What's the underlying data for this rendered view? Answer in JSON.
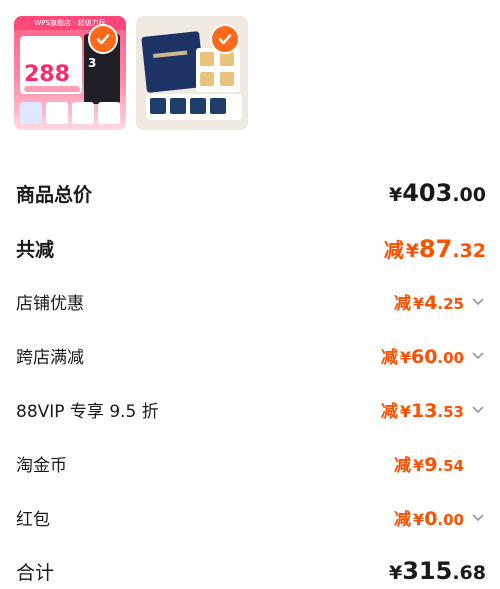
{
  "products": [
    {
      "name": "wps-product-thumb",
      "selected": true,
      "texts": {
        "band": "WPS旗舰店 · 超级力荐",
        "promo_number": "288",
        "badge": "3"
      }
    },
    {
      "name": "cookie-product-thumb",
      "selected": true
    }
  ],
  "summary": {
    "total_price": {
      "label": "商品总价",
      "yen": "¥",
      "int": "403",
      "dec": ".00"
    },
    "total_discount": {
      "label": "共减",
      "prefix": "减",
      "yen": "¥",
      "int": "87",
      "dec": ".32"
    },
    "items": [
      {
        "label": "店铺优惠",
        "prefix": "减",
        "yen": "¥",
        "int": "4",
        "dec": ".25",
        "expand": true
      },
      {
        "label": "跨店满减",
        "prefix": "减",
        "yen": "¥",
        "int": "60",
        "dec": ".00",
        "expand": true
      },
      {
        "label": "88VIP 专享 9.5 折",
        "prefix": "减",
        "yen": "¥",
        "int": "13",
        "dec": ".53",
        "expand": true
      },
      {
        "label": "淘金币",
        "prefix": "减",
        "yen": "¥",
        "int": "9",
        "dec": ".54",
        "expand": false
      },
      {
        "label": "红包",
        "prefix": "减",
        "yen": "¥",
        "int": "0",
        "dec": ".00",
        "expand": true
      }
    ],
    "grand_total": {
      "label": "合计",
      "yen": "¥",
      "int": "315",
      "dec": ".68"
    }
  },
  "colors": {
    "accent": "#ff5000",
    "check": "#ff6a1a"
  },
  "icons": {
    "selected": "check-icon",
    "expand": "chevron-down-icon"
  }
}
